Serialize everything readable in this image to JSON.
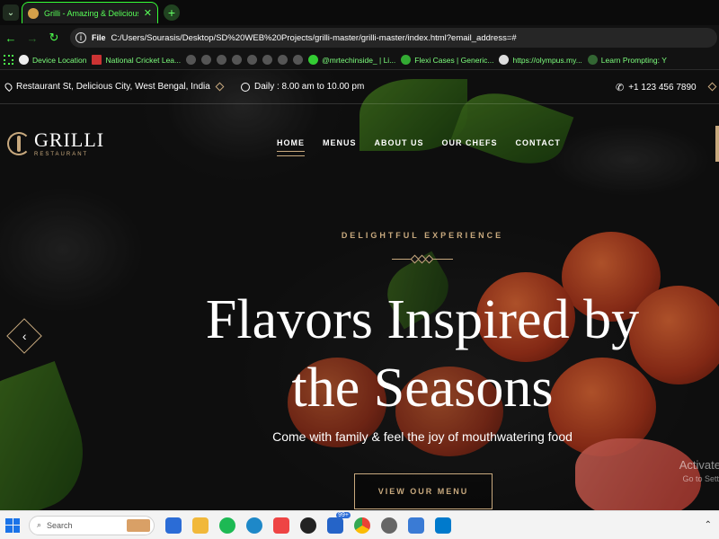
{
  "browser": {
    "tab_title": "Grilli - Amazing & Delicious Fo",
    "address": "C:/Users/Sourasis/Desktop/SD%20WEB%20Projects/grilli-master/grilli-master/index.html?email_address=#",
    "file_badge": "File",
    "bookmarks": [
      "Device Location",
      "National Cricket Lea...",
      "@mrtechinside_ | Li...",
      "Flexi Cases | Generic...",
      "https://olympus.my...",
      "Learn Prompting: Y"
    ]
  },
  "site": {
    "address": "Restaurant St, Delicious City, West Bengal, India",
    "hours": "Daily : 8.00 am to 10.00 pm",
    "phone": "+1 123 456 7890",
    "logo_name": "GRILLI",
    "logo_sub": "RESTAURANT",
    "nav": [
      "HOME",
      "MENUS",
      "ABOUT US",
      "OUR CHEFS",
      "CONTACT"
    ],
    "kicker": "DELIGHTFUL EXPERIENCE",
    "headline_1": "Flavors Inspired by",
    "headline_2": "the Seasons",
    "subline": "Come with family & feel the joy of mouthwatering food",
    "cta": "VIEW OUR MENU",
    "accent_color": "#c8a97e"
  },
  "windows": {
    "activate": "Activate",
    "activate_sub": "Go to Setti"
  },
  "taskbar": {
    "search_placeholder": "Search",
    "badge": "99+"
  }
}
